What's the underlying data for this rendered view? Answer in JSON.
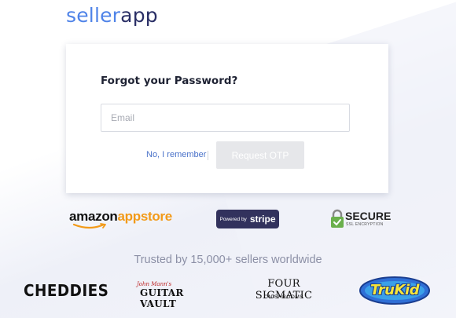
{
  "brand": {
    "logo_part1": "seller",
    "logo_part2": "app",
    "accent_color": "#4f83e8",
    "dark_color": "#2a2f66"
  },
  "form": {
    "title": "Forgot your Password?",
    "email_placeholder": "Email",
    "email_value": "",
    "remember_link": "No, I remember",
    "submit_label": "Request OTP",
    "submit_disabled": true
  },
  "badges": {
    "amazon": {
      "part1": "amazon",
      "part2": "appstore",
      "icon": "amazon-smile-icon"
    },
    "stripe": {
      "prefix": "Powered by",
      "name": "stripe"
    },
    "secure": {
      "title": "SECURE",
      "subtitle": "SSL ENCRYPTION",
      "icon": "lock-check-icon"
    }
  },
  "trusted_text": "Trusted by 15,000+ sellers worldwide",
  "client_logos": {
    "cheddies": "CHEDDIES",
    "guitar_small": "John Mann's",
    "guitar_big": "GUITAR VAULT",
    "sigmatic_main": "FOUR SIGMATIC",
    "sigmatic_sub": "ON SHROOMS",
    "trukid": "TruKid"
  }
}
